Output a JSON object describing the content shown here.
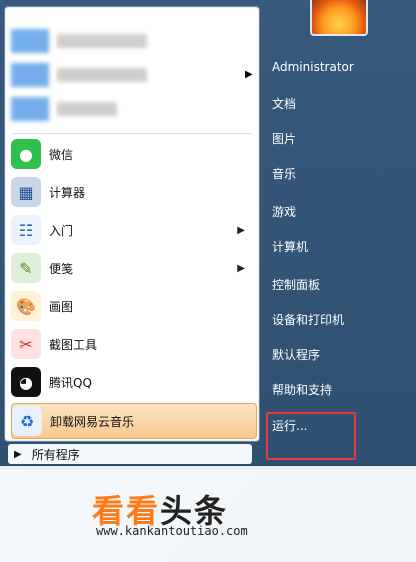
{
  "start_menu": {
    "pinned": [
      {
        "label": "微信",
        "icon": "wechat-icon"
      },
      {
        "label": "计算器",
        "icon": "calculator-icon"
      },
      {
        "label": "入门",
        "icon": "getting-started-icon",
        "has_submenu": true
      },
      {
        "label": "便笺",
        "icon": "sticky-notes-icon",
        "has_submenu": true
      },
      {
        "label": "画图",
        "icon": "paint-icon"
      },
      {
        "label": "截图工具",
        "icon": "snipping-tool-icon"
      },
      {
        "label": "腾讯QQ",
        "icon": "qq-icon"
      },
      {
        "label": "卸载网易云音乐",
        "icon": "uninstall-icon",
        "highlighted": true
      }
    ],
    "all_programs_label": "所有程序",
    "right": {
      "user": "Administrator",
      "links": [
        "文档",
        "图片",
        "音乐",
        "游戏",
        "计算机",
        "控制面板",
        "设备和打印机",
        "默认程序",
        "帮助和支持",
        "运行..."
      ]
    }
  },
  "watermark": {
    "title_part1": "看看",
    "title_part2": "头条",
    "url": "www.kankantoutiao.com"
  }
}
